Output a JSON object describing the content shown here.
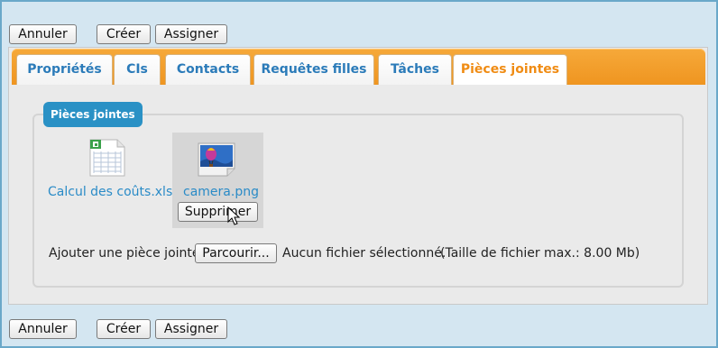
{
  "toolbar_top": {
    "cancel": "Annuler",
    "create": "Créer",
    "assign": "Assigner"
  },
  "toolbar_bottom": {
    "cancel": "Annuler",
    "create": "Créer",
    "assign": "Assigner"
  },
  "tabs": [
    {
      "label": "Propriétés"
    },
    {
      "label": "CIs"
    },
    {
      "label": "Contacts"
    },
    {
      "label": "Requêtes filles"
    },
    {
      "label": "Tâches"
    },
    {
      "label": "Pièces jointes"
    }
  ],
  "attachments": {
    "legend": "Pièces jointes",
    "items": [
      {
        "name": "Calcul des coûts.xlsx",
        "icon": "spreadsheet-icon"
      },
      {
        "name": "camera.png",
        "icon": "image-icon",
        "delete_label": "Supprimer"
      }
    ],
    "add_label": "Ajouter une pièce jointe:",
    "browse_label": "Parcourir...",
    "no_file_text": "Aucun fichier sélectionné.",
    "max_size_text": "(Taille de fichier max.: 8.00 Mb)"
  },
  "colors": {
    "accent_orange": "#f08c14",
    "link_blue": "#2a8bc7",
    "legend_blue": "#2a91c5"
  }
}
